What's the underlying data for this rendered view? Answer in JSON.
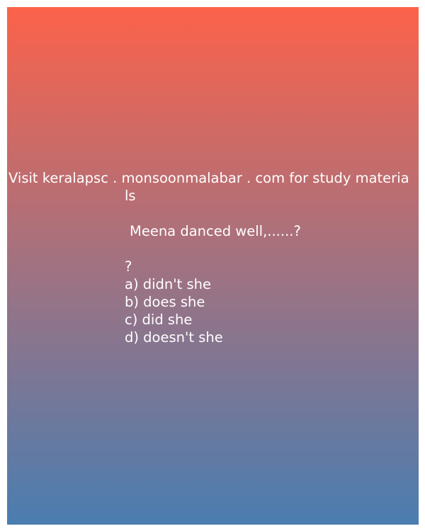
{
  "header": {
    "line1": "Visit keralapsc . monsoonmalabar . com for study materia",
    "line2": "ls"
  },
  "question": {
    "text": "Meena danced well,......?",
    "mark": "?"
  },
  "options": [
    "a) didn't she",
    "b) does she",
    "c) did she",
    "d) doesn't she"
  ],
  "colors": {
    "gradient_top": "#fc624a",
    "gradient_bottom": "#4a7db0",
    "text": "#ffffff"
  }
}
